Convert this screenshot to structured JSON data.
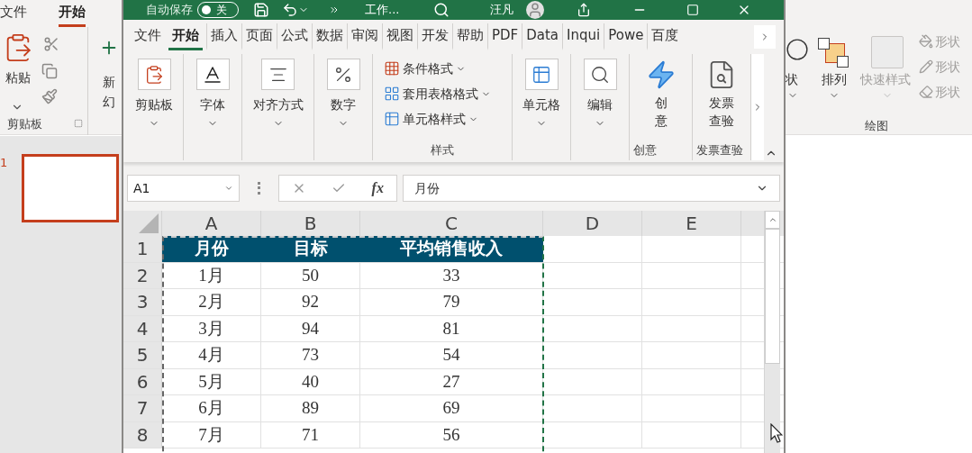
{
  "powerpoint": {
    "tabs": [
      {
        "label": "文件",
        "selected": false
      },
      {
        "label": "开始",
        "selected": true
      }
    ],
    "paste": "粘贴",
    "new_slide": [
      "新",
      "幻"
    ],
    "clipboard_group": "剪贴板",
    "shape": "状",
    "arrange": "排列",
    "quick_styles": "快速样式",
    "shape_items": [
      "形状",
      "形状",
      "形状"
    ],
    "drawing_group": "绘图",
    "slides": [
      {
        "number": "1",
        "selected": true
      }
    ]
  },
  "excel": {
    "title_bar": {
      "autosave": "自动保存",
      "toggle": "关",
      "toggle_on": false,
      "filename": "工作...",
      "user": "汪凡"
    },
    "tabs": [
      {
        "label": "文件",
        "selected": false
      },
      {
        "label": "开始",
        "selected": true
      },
      {
        "label": "插入",
        "selected": false
      },
      {
        "label": "页面",
        "selected": false
      },
      {
        "label": "公式",
        "selected": false
      },
      {
        "label": "数据",
        "selected": false
      },
      {
        "label": "审阅",
        "selected": false
      },
      {
        "label": "视图",
        "selected": false
      },
      {
        "label": "开发",
        "selected": false
      },
      {
        "label": "帮助",
        "selected": false
      },
      {
        "label": "PDF",
        "selected": false
      },
      {
        "label": "Data",
        "selected": false
      },
      {
        "label": "Inqui",
        "selected": false
      },
      {
        "label": "Powe",
        "selected": false
      },
      {
        "label": "百度",
        "selected": false
      }
    ],
    "ribbon_groups": [
      {
        "kind": "dropdown",
        "label": "剪贴板"
      },
      {
        "kind": "dropdown",
        "label": "字体"
      },
      {
        "kind": "dropdown",
        "label": "对齐方式"
      },
      {
        "kind": "dropdown",
        "label": "数字"
      },
      {
        "kind": "styles",
        "items": [
          "条件格式",
          "套用表格格式",
          "单元格样式"
        ],
        "group": "样式"
      },
      {
        "kind": "dropdown",
        "label": "单元格"
      },
      {
        "kind": "dropdown",
        "label": "编辑"
      },
      {
        "kind": "big",
        "lines": [
          "创",
          "意"
        ],
        "group": "创意"
      },
      {
        "kind": "big",
        "lines": [
          "发票",
          "查验"
        ],
        "group": "发票查验"
      }
    ],
    "name_box": "A1",
    "fx": "fx",
    "formula": "月份",
    "columns": [
      "A",
      "B",
      "C",
      "D",
      "E"
    ],
    "rows": [
      {
        "number": "1",
        "kind": "header",
        "cells": [
          "月份",
          "目标",
          "平均销售收入"
        ]
      },
      {
        "number": "2",
        "kind": "data",
        "cells": [
          "1月",
          "50",
          "33"
        ]
      },
      {
        "number": "3",
        "kind": "data",
        "cells": [
          "2月",
          "92",
          "79"
        ]
      },
      {
        "number": "4",
        "kind": "data",
        "cells": [
          "3月",
          "94",
          "81"
        ]
      },
      {
        "number": "5",
        "kind": "data",
        "cells": [
          "4月",
          "73",
          "54"
        ]
      },
      {
        "number": "6",
        "kind": "data",
        "cells": [
          "5月",
          "40",
          "27"
        ]
      },
      {
        "number": "7",
        "kind": "data",
        "cells": [
          "6月",
          "89",
          "69"
        ]
      },
      {
        "number": "8",
        "kind": "data",
        "cells": [
          "7月",
          "71",
          "56"
        ]
      }
    ]
  }
}
